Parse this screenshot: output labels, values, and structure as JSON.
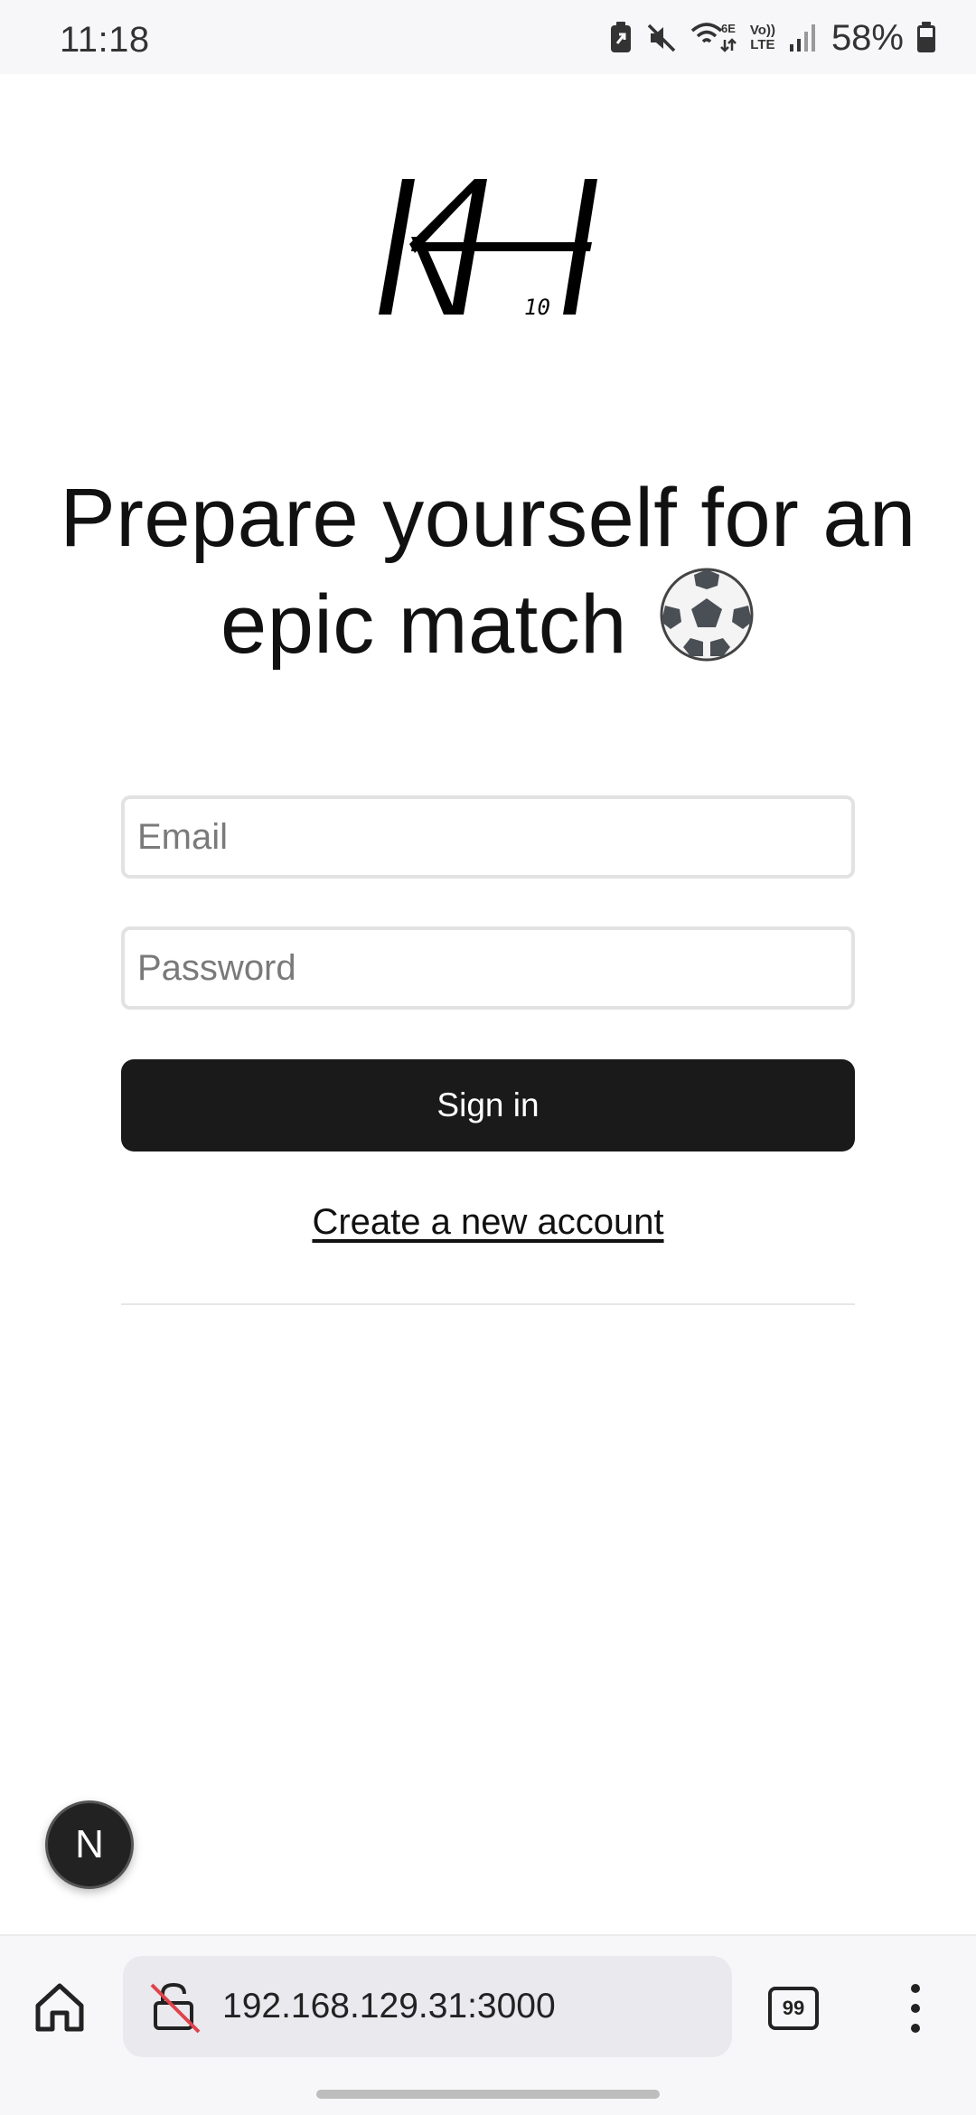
{
  "status_bar": {
    "time": "11:18",
    "wifi_label": "6E",
    "volte_label_top": "Vo))",
    "volte_label_bottom": "LTE",
    "battery_percent": "58%"
  },
  "logo": {
    "main": "KH",
    "number": "10"
  },
  "headline": {
    "text": "Prepare yourself for an epic match"
  },
  "form": {
    "email_placeholder": "Email",
    "password_placeholder": "Password",
    "signin_label": "Sign in",
    "create_account_link": "Create a new account"
  },
  "dev_badge": {
    "label": "N"
  },
  "browser": {
    "url": "192.168.129.31:3000",
    "tab_count": "99"
  },
  "colors": {
    "button_bg": "#1a1a1a",
    "field_border": "#e2e2e2",
    "page_bg": "#ffffff",
    "chrome_bg": "#f7f7f9"
  }
}
